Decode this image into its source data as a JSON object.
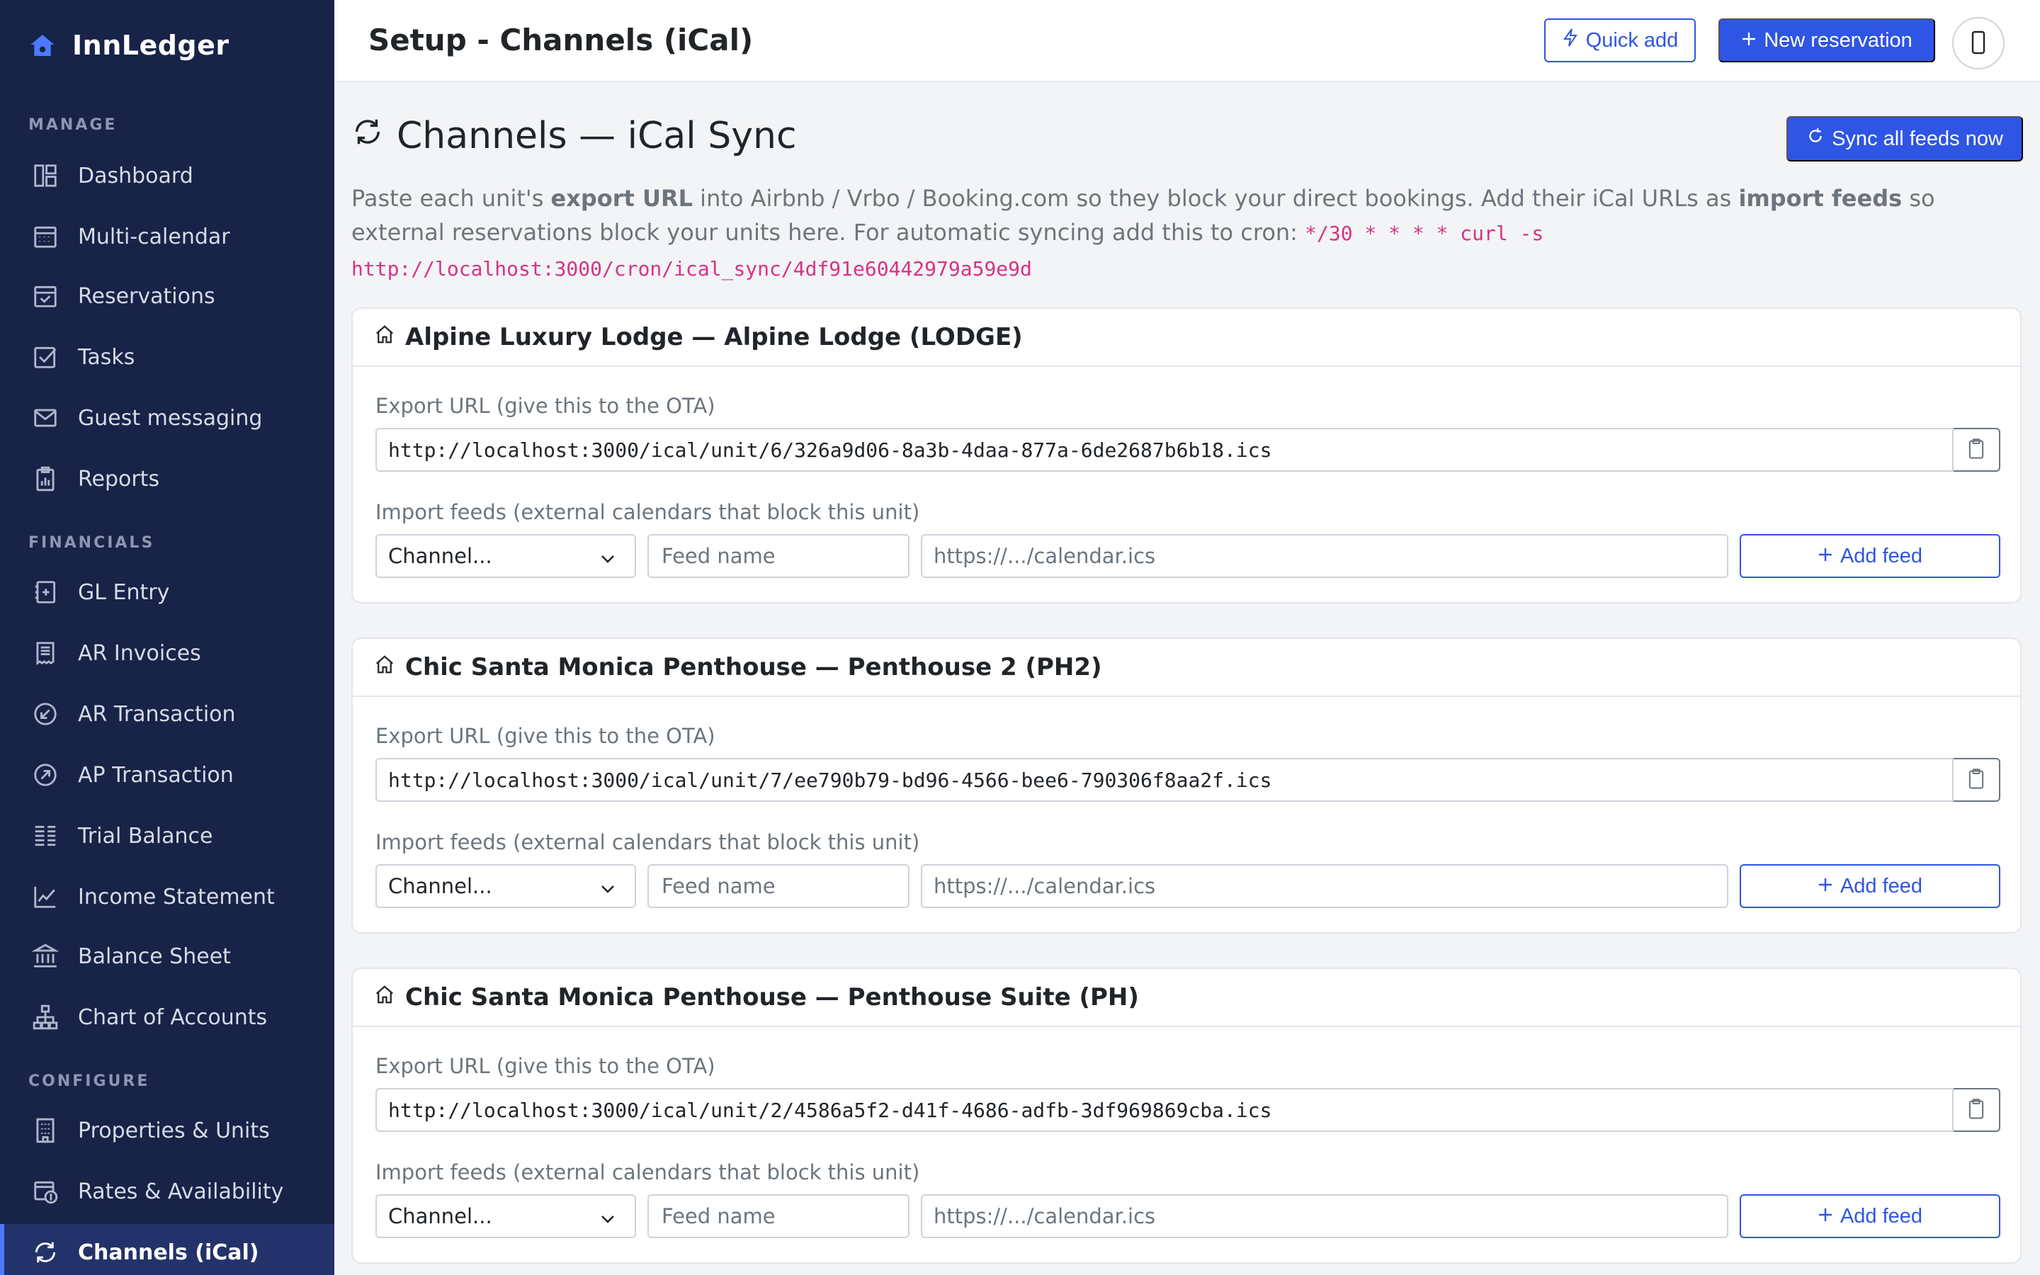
{
  "app": {
    "name": "InnLedger",
    "brand_color": "#2f55e4",
    "sidebar_bg": "#172347"
  },
  "sidebar": {
    "sections": [
      {
        "label": "MANAGE",
        "items": [
          {
            "label": "Dashboard",
            "icon": "dashboard-icon"
          },
          {
            "label": "Multi-calendar",
            "icon": "calendar-grid-icon"
          },
          {
            "label": "Reservations",
            "icon": "calendar-check-icon"
          },
          {
            "label": "Tasks",
            "icon": "checkbox-icon"
          },
          {
            "label": "Guest messaging",
            "icon": "envelope-icon"
          },
          {
            "label": "Reports",
            "icon": "clipboard-chart-icon"
          }
        ]
      },
      {
        "label": "FINANCIALS",
        "items": [
          {
            "label": "GL Entry",
            "icon": "journal-plus-icon"
          },
          {
            "label": "AR Invoices",
            "icon": "receipt-icon"
          },
          {
            "label": "AR Transaction",
            "icon": "arrow-down-left-circle-icon"
          },
          {
            "label": "AP Transaction",
            "icon": "arrow-up-right-circle-icon"
          },
          {
            "label": "Trial Balance",
            "icon": "list-columns-icon"
          },
          {
            "label": "Income Statement",
            "icon": "graph-up-icon"
          },
          {
            "label": "Balance Sheet",
            "icon": "bank-icon"
          },
          {
            "label": "Chart of Accounts",
            "icon": "diagram-icon"
          }
        ]
      },
      {
        "label": "CONFIGURE",
        "items": [
          {
            "label": "Properties & Units",
            "icon": "building-icon"
          },
          {
            "label": "Rates & Availability",
            "icon": "calendar-dollar-icon"
          },
          {
            "label": "Channels (iCal)",
            "icon": "sync-icon",
            "active": true
          }
        ]
      }
    ]
  },
  "topbar": {
    "title": "Setup - Channels (iCal)",
    "quick_add_label": "Quick add",
    "new_reservation_label": "New reservation"
  },
  "main": {
    "heading": "Channels — iCal Sync",
    "sync_all_label": "Sync all feeds now",
    "intro": {
      "t1": "Paste each unit's ",
      "b1": "export URL",
      "t2": " into Airbnb / Vrbo / Booking.com so they block your direct bookings. Add their iCal URLs as ",
      "b2": "import feeds",
      "t3": " so external reservations block your units here. For automatic syncing add this to cron: ",
      "cron": "*/30 * * * * curl -s http://localhost:3000/cron/ical_sync/4df91e60442979a59e9d"
    },
    "export_label": "Export URL (give this to the OTA)",
    "import_label": "Import feeds (external calendars that block this unit)",
    "channel_placeholder": "Channel...",
    "feed_name_placeholder": "Feed name",
    "feed_url_placeholder": "https://.../calendar.ics",
    "add_feed_label": "Add feed",
    "units": [
      {
        "title": "Alpine Luxury Lodge — Alpine Lodge (LODGE)",
        "export_url": "http://localhost:3000/ical/unit/6/326a9d06-8a3b-4daa-877a-6de2687b6b18.ics"
      },
      {
        "title": "Chic Santa Monica Penthouse — Penthouse 2 (PH2)",
        "export_url": "http://localhost:3000/ical/unit/7/ee790b79-bd96-4566-bee6-790306f8aa2f.ics"
      },
      {
        "title": "Chic Santa Monica Penthouse — Penthouse Suite (PH)",
        "export_url": "http://localhost:3000/ical/unit/2/4586a5f2-d41f-4686-adfb-3df969869cba.ics"
      }
    ]
  }
}
